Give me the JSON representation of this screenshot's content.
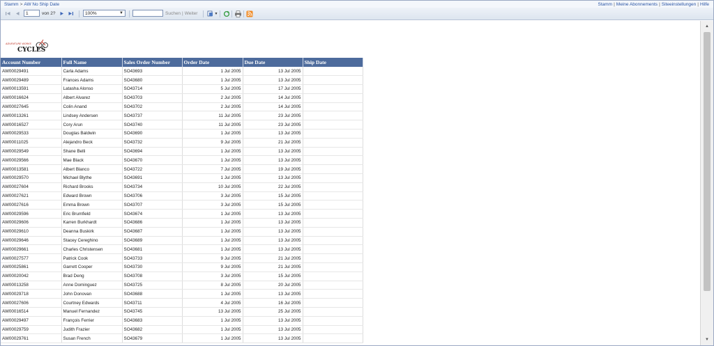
{
  "breadcrumb": {
    "root": "Stamm",
    "separator": ">",
    "current": "AW No Ship Date"
  },
  "top_links": [
    "Stamm",
    "Meine Abonnements",
    "Siteeinstellungen",
    "Hilfe"
  ],
  "toolbar": {
    "page_value": "1",
    "page_of": "von 2?",
    "zoom": "100%",
    "find_placeholder": "",
    "find_label": "Suchen",
    "next_label": "Weiter",
    "icons": [
      "first-page-icon",
      "previous-page-icon",
      "next-page-icon",
      "last-page-icon",
      "export-icon",
      "refresh-icon",
      "print-icon",
      "atom-feed-icon"
    ]
  },
  "logo": {
    "top": "ADVENTURE WORKS",
    "bottom": "CYCLES"
  },
  "table": {
    "columns": [
      "Account Number",
      "Full Name",
      "Sales Order Number",
      "Order Date",
      "Due Date",
      "Ship Date"
    ],
    "rows": [
      [
        "AW00029491",
        "Carla Adams",
        "SO43693",
        "1 Jul 2005",
        "13 Jul 2005",
        ""
      ],
      [
        "AW00029489",
        "Frances Adams",
        "SO43680",
        "1 Jul 2005",
        "13 Jul 2005",
        ""
      ],
      [
        "AW00013591",
        "Latasha Alonso",
        "SO43714",
        "5 Jul 2005",
        "17 Jul 2005",
        ""
      ],
      [
        "AW00016624",
        "Albert Alvarez",
        "SO43703",
        "2 Jul 2005",
        "14 Jul 2005",
        ""
      ],
      [
        "AW00027645",
        "Colin Anand",
        "SO43702",
        "2 Jul 2005",
        "14 Jul 2005",
        ""
      ],
      [
        "AW00013261",
        "Lindsey Andersen",
        "SO43737",
        "11 Jul 2005",
        "23 Jul 2005",
        ""
      ],
      [
        "AW00016527",
        "Cory Arun",
        "SO43740",
        "11 Jul 2005",
        "23 Jul 2005",
        ""
      ],
      [
        "AW00029533",
        "Douglas Baldwin",
        "SO43690",
        "1 Jul 2005",
        "13 Jul 2005",
        ""
      ],
      [
        "AW00011025",
        "Alejandro Beck",
        "SO43732",
        "9 Jul 2005",
        "21 Jul 2005",
        ""
      ],
      [
        "AW00029549",
        "Shane Belli",
        "SO43694",
        "1 Jul 2005",
        "13 Jul 2005",
        ""
      ],
      [
        "AW00029566",
        "Mae Black",
        "SO43670",
        "1 Jul 2005",
        "13 Jul 2005",
        ""
      ],
      [
        "AW00013581",
        "Albert Blanco",
        "SO43722",
        "7 Jul 2005",
        "19 Jul 2005",
        ""
      ],
      [
        "AW00029570",
        "Michael Blythe",
        "SO43691",
        "1 Jul 2005",
        "13 Jul 2005",
        ""
      ],
      [
        "AW00027604",
        "Richard Brooks",
        "SO43734",
        "10 Jul 2005",
        "22 Jul 2005",
        ""
      ],
      [
        "AW00027621",
        "Edward Brown",
        "SO43706",
        "3 Jul 2005",
        "15 Jul 2005",
        ""
      ],
      [
        "AW00027616",
        "Emma Brown",
        "SO43707",
        "3 Jul 2005",
        "15 Jul 2005",
        ""
      ],
      [
        "AW00029596",
        "Eric Brumfield",
        "SO43674",
        "1 Jul 2005",
        "13 Jul 2005",
        ""
      ],
      [
        "AW00029606",
        "Karren Burkhardt",
        "SO43686",
        "1 Jul 2005",
        "13 Jul 2005",
        ""
      ],
      [
        "AW00029610",
        "Deanna Buskirk",
        "SO43687",
        "1 Jul 2005",
        "13 Jul 2005",
        ""
      ],
      [
        "AW00029646",
        "Stacey Cereghino",
        "SO43689",
        "1 Jul 2005",
        "13 Jul 2005",
        ""
      ],
      [
        "AW00029661",
        "Charles Christensen",
        "SO43681",
        "1 Jul 2005",
        "13 Jul 2005",
        ""
      ],
      [
        "AW00027577",
        "Patrick Cook",
        "SO43733",
        "9 Jul 2005",
        "21 Jul 2005",
        ""
      ],
      [
        "AW00025861",
        "Garrett Cooper",
        "SO43730",
        "9 Jul 2005",
        "21 Jul 2005",
        ""
      ],
      [
        "AW00020042",
        "Brad Deng",
        "SO43708",
        "3 Jul 2005",
        "15 Jul 2005",
        ""
      ],
      [
        "AW00013258",
        "Anne Dominguez",
        "SO43725",
        "8 Jul 2005",
        "20 Jul 2005",
        ""
      ],
      [
        "AW00029718",
        "John Donovan",
        "SO43688",
        "1 Jul 2005",
        "13 Jul 2005",
        ""
      ],
      [
        "AW00027606",
        "Courtney Edwards",
        "SO43711",
        "4 Jul 2005",
        "16 Jul 2005",
        ""
      ],
      [
        "AW00016514",
        "Manuel Fernandez",
        "SO43745",
        "13 Jul 2005",
        "25 Jul 2005",
        ""
      ],
      [
        "AW00029497",
        "François Ferrier",
        "SO43683",
        "1 Jul 2005",
        "13 Jul 2005",
        ""
      ],
      [
        "AW00029759",
        "Judith Frazier",
        "SO43682",
        "1 Jul 2005",
        "13 Jul 2005",
        ""
      ],
      [
        "AW00029761",
        "Susan French",
        "SO43679",
        "1 Jul 2005",
        "13 Jul 2005",
        ""
      ]
    ]
  },
  "colors": {
    "header_bg": "#4d6b9c",
    "link": "#2a55a5",
    "toolbar_bg": "#dde5ef"
  }
}
